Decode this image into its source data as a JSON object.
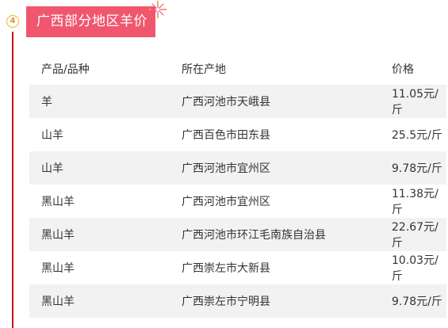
{
  "section": {
    "number": "4",
    "title": "广西部分地区羊价"
  },
  "table": {
    "headers": [
      "产品/品种",
      "所在产地",
      "价格"
    ],
    "rows": [
      [
        "羊",
        "广西河池市天峨县",
        "11.05元/斤"
      ],
      [
        "山羊",
        "广西百色市田东县",
        "25.5元/斤"
      ],
      [
        "山羊",
        "广西河池市宜州区",
        "9.78元/斤"
      ],
      [
        "黑山羊",
        "广西河池市宜州区",
        "11.38元/斤"
      ],
      [
        "黑山羊",
        "广西河池市环江毛南族自治县",
        "22.67元/斤"
      ],
      [
        "黑山羊",
        "广西崇左市大新县",
        "10.03元/斤"
      ],
      [
        "黑山羊",
        "广西崇左市宁明县",
        "9.78元/斤"
      ]
    ]
  },
  "colors": {
    "accent": "#f0576f",
    "timeline": "#c8101c",
    "badge_border": "#f0b429",
    "row_stripe": "#f2f2f2"
  },
  "icons": {
    "decoration": "firework-icon"
  }
}
